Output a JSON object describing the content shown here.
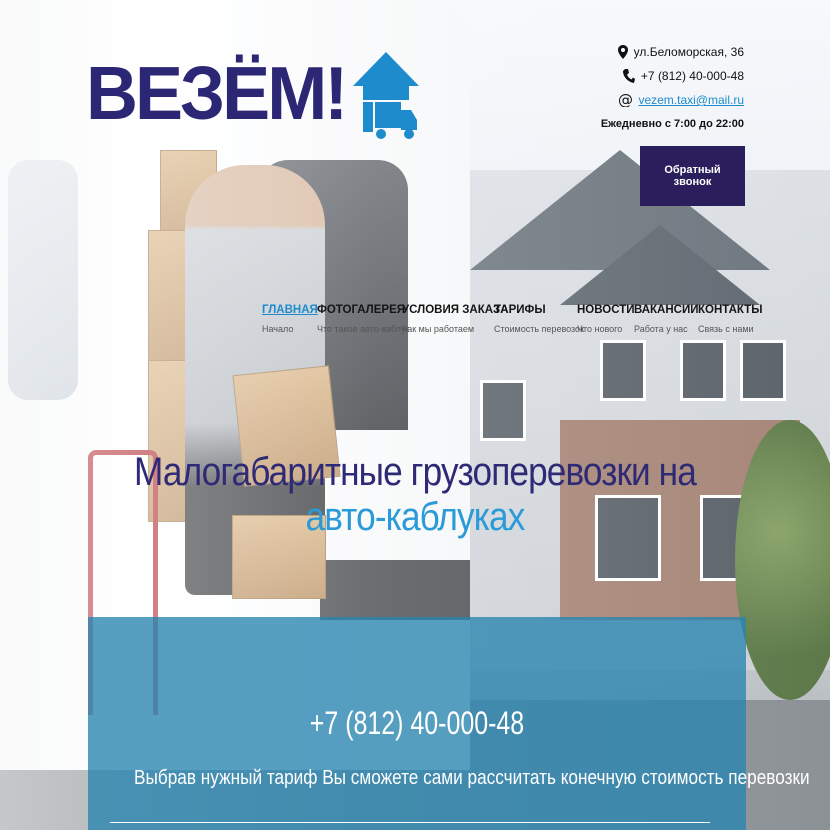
{
  "logo": {
    "text": "ВЕЗЁМ!",
    "icon": "house-truck-icon",
    "color": "#2c2775",
    "accent": "#1d8bcc"
  },
  "contacts": {
    "address": "ул.Беломорская, 36",
    "phone": "+7 (812) 40-000-48",
    "email": "vezem.taxi@mail.ru",
    "hours": "Ежедневно с 7:00 до 22:00",
    "callback_label": "Обратный звонок"
  },
  "nav": {
    "items": [
      {
        "title": "ГЛАВНАЯ",
        "sub": "Начало",
        "active": true
      },
      {
        "title": "ФОТОГАЛЕРЕЯ",
        "sub": "Что такое авто-каблук"
      },
      {
        "title": "УСЛОВИЯ ЗАКАЗА",
        "sub": "Как мы работаем"
      },
      {
        "title": "ТАРИФЫ",
        "sub": "Стоимость перевозок"
      },
      {
        "title": "НОВОСТИ",
        "sub": "Что нового"
      },
      {
        "title": "ВАКАНСИИ",
        "sub": "Работа у нас"
      },
      {
        "title": "КОНТАКТЫ",
        "sub": "Связь с нами"
      }
    ]
  },
  "hero": {
    "headline_1": "Малогабаритные грузоперевозки на",
    "headline_2": "авто-каблуках",
    "phone": "+7 (812) 40-000-48",
    "text": "Выбрав нужный тариф Вы сможете сами рассчитать конечную стоимость перевозки"
  },
  "colors": {
    "brand_dark": "#2a1f5c",
    "link": "#1d8bcc",
    "panel": "#2884b0"
  }
}
